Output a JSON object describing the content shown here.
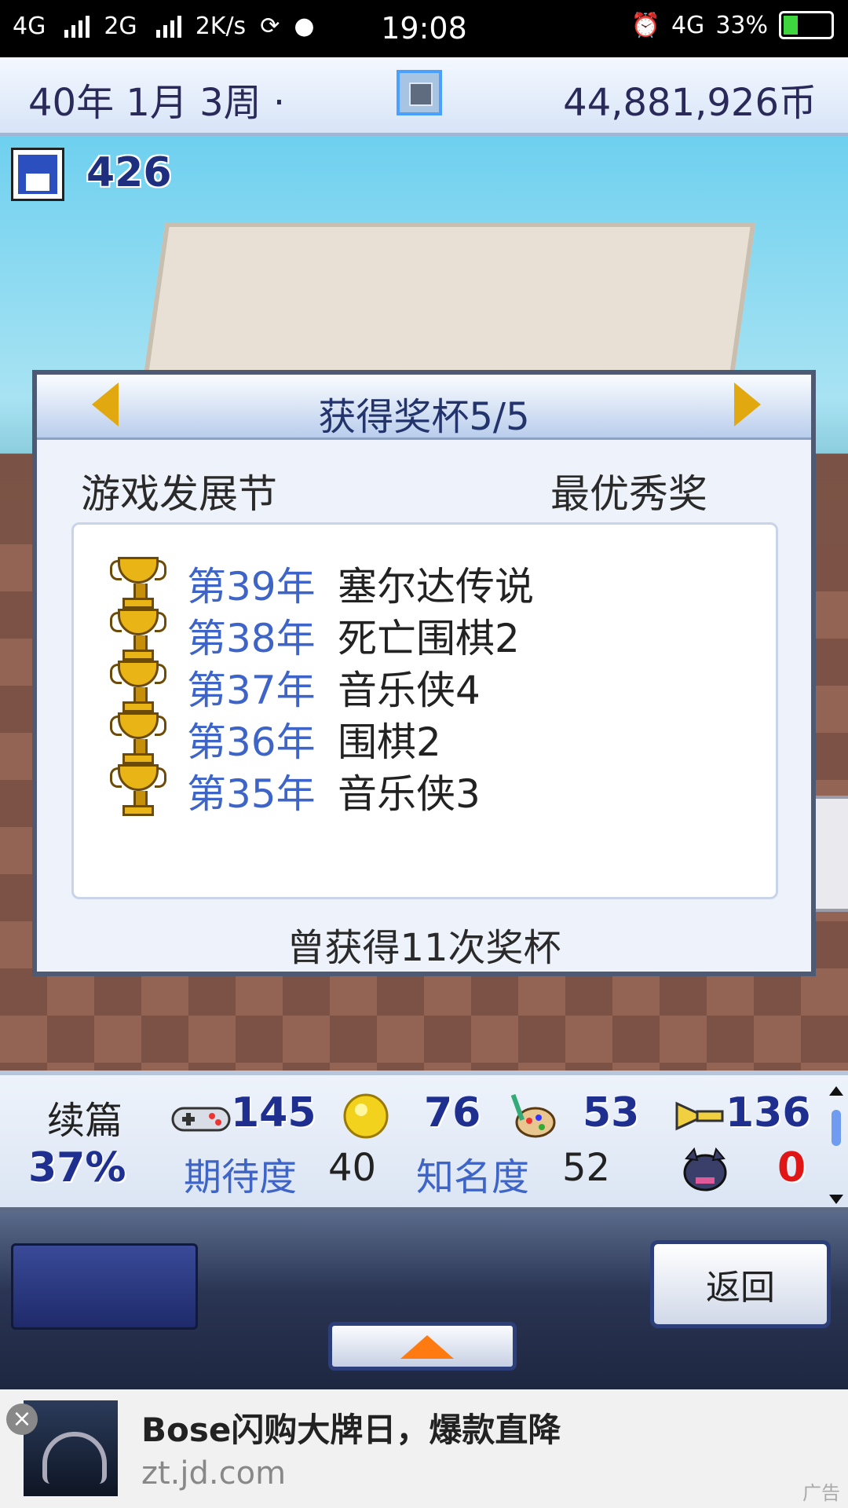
{
  "status_bar": {
    "left": [
      "4G",
      "2G",
      "2K/s"
    ],
    "time": "19:08",
    "network": "4G",
    "battery": "33%"
  },
  "top_bar": {
    "date": "40年 1月 3周 ·",
    "money": "44,881,926币"
  },
  "save": {
    "count": "426"
  },
  "dialog": {
    "title": "获得奖杯5/5",
    "category": "游戏发展节",
    "award": "最优秀奖",
    "trophies": [
      {
        "year": "第39年",
        "game": "塞尔达传说"
      },
      {
        "year": "第38年",
        "game": "死亡围棋2"
      },
      {
        "year": "第37年",
        "game": "音乐侠4"
      },
      {
        "year": "第36年",
        "game": "围棋2"
      },
      {
        "year": "第35年",
        "game": "音乐侠3"
      }
    ],
    "footer": "曾获得11次奖杯"
  },
  "stats": {
    "type_label": "续篇",
    "percent": "37%",
    "controller_value": "145",
    "coin_value": "76",
    "paint_value": "53",
    "sound_value": "136",
    "expectation_label": "期待度",
    "expectation_value": "40",
    "fame_label": "知名度",
    "fame_value": "52",
    "bug_value": "0"
  },
  "controls": {
    "back_label": "返回"
  },
  "ad": {
    "title": "Bose闪购大牌日，爆款直降",
    "url": "zt.jd.com",
    "tag": "广告"
  }
}
